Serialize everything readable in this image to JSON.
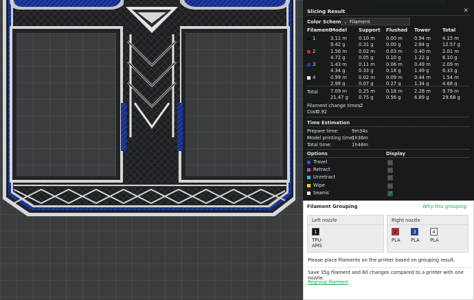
{
  "top_button": "",
  "panel": {
    "title": "Slicing Result",
    "close": "✕",
    "color_scheme_label": "Color Scheme",
    "color_scheme_value": "Filament",
    "headers": [
      "Filament",
      "Model",
      "Support",
      "Flushed",
      "Tower",
      "Total"
    ],
    "rows": [
      {
        "id": "1",
        "color": "#111111",
        "model": [
          "3.11 m",
          "9.42 g"
        ],
        "support": [
          "0.10 m",
          "0.31 g"
        ],
        "flushed": [
          "0.00 m",
          "0.00 g"
        ],
        "tower": [
          "0.94 m",
          "2.84 g"
        ],
        "total": [
          "4.15 m",
          "12.57 g"
        ]
      },
      {
        "id": "2",
        "color": "#c62828",
        "model": [
          "1.56 m",
          "4.72 g"
        ],
        "support": [
          "0.02 m",
          "0.05 g"
        ],
        "flushed": [
          "0.03 m",
          "0.10 g"
        ],
        "tower": [
          "0.40 m",
          "1.22 g"
        ],
        "total": [
          "2.01 m",
          "6.10 g"
        ]
      },
      {
        "id": "3",
        "color": "#1a3fa8",
        "model": [
          "1.43 m",
          "4.34 g"
        ],
        "support": [
          "0.11 m",
          "0.33 g"
        ],
        "flushed": [
          "0.06 m",
          "0.18 g"
        ],
        "tower": [
          "0.49 m",
          "1.49 g"
        ],
        "total": [
          "2.09 m",
          "6.33 g"
        ]
      },
      {
        "id": "4",
        "color": "#f2f2f2",
        "model": [
          "0.99 m",
          "2.99 g"
        ],
        "support": [
          "0.02 m",
          "0.07 g"
        ],
        "flushed": [
          "0.09 m",
          "0.27 g"
        ],
        "tower": [
          "0.44 m",
          "1.34 g"
        ],
        "total": [
          "1.54 m",
          "4.68 g"
        ]
      }
    ],
    "total": {
      "label": "Total",
      "model": [
        "7.09 m",
        "21.47 g"
      ],
      "support": [
        "0.25 m",
        "0.75 g"
      ],
      "flushed": [
        "0.18 m",
        "0.56 g"
      ],
      "tower": [
        "2.28 m",
        "6.89 g"
      ],
      "total": [
        "9.79 m",
        "29.68 g"
      ]
    },
    "change_times_label": "Filament change times:",
    "change_times_value": "2",
    "cost_label": "Cost:",
    "cost_value": "0.92",
    "time_title": "Time Estimation",
    "prepare_label": "Prepare time:",
    "prepare_value": "9m34s",
    "model_time_label": "Model printing time:",
    "model_time_value": "1h36m",
    "total_time_label": "Total time:",
    "total_time_value": "1h46m",
    "options_label": "Options",
    "display_label": "Display",
    "options": [
      {
        "label": "Travel",
        "color": "#3b4fd6",
        "checked": false
      },
      {
        "label": "Retract",
        "color": "#d63bb8",
        "checked": false
      },
      {
        "label": "Unretract",
        "color": "#3bb6d6",
        "checked": false
      },
      {
        "label": "Wipe",
        "color": "#e8d21a",
        "checked": false
      },
      {
        "label": "Seams",
        "color": "#e6e6e6",
        "checked": true
      }
    ]
  },
  "grouping": {
    "title": "Filament Grouping",
    "why_link": "Why this grouping",
    "left_nozzle": "Left nozzle",
    "right_nozzle": "Right nozzle",
    "left_filaments": [
      {
        "id": "1",
        "color": "#111111",
        "text_color": "#ffffff",
        "type": "TPU-\nAMS"
      }
    ],
    "right_filaments": [
      {
        "id": "2",
        "color": "#c62828",
        "text_color": "#111111",
        "type": "PLA"
      },
      {
        "id": "3",
        "color": "#1a3fa8",
        "text_color": "#ffffff",
        "type": "PLA"
      },
      {
        "id": "4",
        "color": "#ffffff",
        "text_color": "#111111",
        "type": "PLA"
      }
    ],
    "place_text": "Please place filaments on the printer based on grouping result.",
    "save_text": "Save 35g filament and 60 changes compared to a printer with one nozzle.",
    "regroup": "Regroup filament"
  }
}
